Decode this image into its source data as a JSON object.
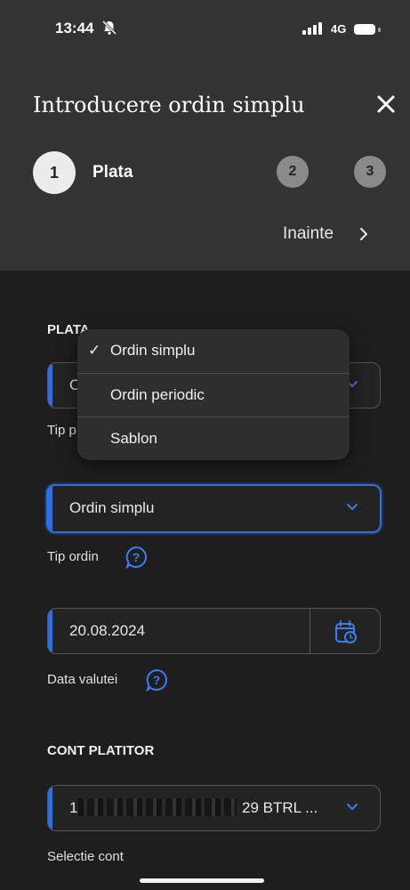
{
  "status_bar": {
    "time": "13:44",
    "network": "4G"
  },
  "header": {
    "title": "Introducere ordin simplu",
    "steps": [
      {
        "number": "1",
        "label": "Plata"
      },
      {
        "number": "2"
      },
      {
        "number": "3"
      }
    ],
    "next_label": "Inainte"
  },
  "plata": {
    "section_title": "PLATA",
    "tip_plata": {
      "value_partial": "O",
      "helper_partial": "Tip p"
    },
    "tip_ordin": {
      "value": "Ordin simplu",
      "helper": "Tip ordin"
    },
    "data_valutei": {
      "value": "20.08.2024",
      "helper": "Data valutei"
    }
  },
  "cont_platitor": {
    "section_title": "CONT PLATITOR",
    "account_prefix": "1",
    "account_suffix": "29 BTRL ...",
    "helper": "Selectie cont"
  },
  "dropdown": {
    "selected_check": "✓",
    "options": [
      "Ordin simplu",
      "Ordin periodic",
      "Sablon"
    ]
  },
  "colors": {
    "accent": "#2f6fe0",
    "header_bg": "#333333",
    "body_bg": "#1e1e1e"
  },
  "icons": [
    "bell-slash-icon",
    "signal-icon",
    "battery-icon",
    "close-icon",
    "chevron-right-icon",
    "chevron-down-icon",
    "help-icon",
    "calendar-icon"
  ]
}
